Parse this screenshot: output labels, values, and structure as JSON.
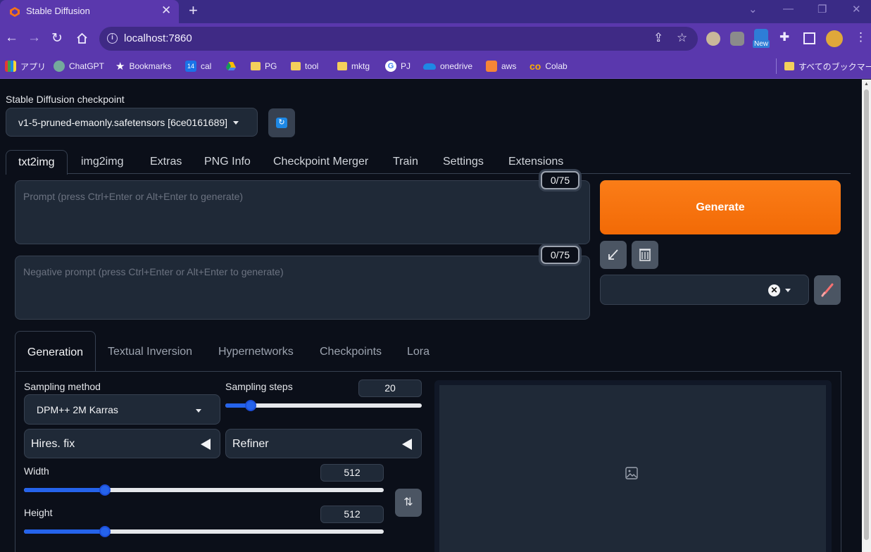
{
  "browser": {
    "tab_title": "Stable Diffusion",
    "close_glyph": "✕",
    "newtab_glyph": "+",
    "url": "localhost:7860",
    "new_badge": "New",
    "bookmarks": [
      {
        "label": "アプリ",
        "icon": "apps-icon"
      },
      {
        "label": "ChatGPT",
        "icon": "chatgpt-icon"
      },
      {
        "label": "Bookmarks",
        "icon": "star-icon"
      },
      {
        "label": "cal",
        "icon": "calendar-icon"
      },
      {
        "label": "",
        "icon": "drive-icon"
      },
      {
        "label": "PG",
        "icon": "folder-icon"
      },
      {
        "label": "tool",
        "icon": "folder-icon"
      },
      {
        "label": "mktg",
        "icon": "folder-icon"
      },
      {
        "label": "PJ",
        "icon": "google-icon"
      },
      {
        "label": "onedrive",
        "icon": "onedrive-icon"
      },
      {
        "label": "aws",
        "icon": "aws-icon"
      },
      {
        "label": "Colab",
        "icon": "colab-icon"
      }
    ],
    "other_bookmarks": "すべてのブックマーク"
  },
  "checkpoint": {
    "label": "Stable Diffusion checkpoint",
    "value": "v1-5-pruned-emaonly.safetensors [6ce0161689]"
  },
  "main_tabs": [
    "txt2img",
    "img2img",
    "Extras",
    "PNG Info",
    "Checkpoint Merger",
    "Train",
    "Settings",
    "Extensions"
  ],
  "prompt": {
    "placeholder": "Prompt (press Ctrl+Enter or Alt+Enter to generate)",
    "counter": "0/75"
  },
  "negative_prompt": {
    "placeholder": "Negative prompt (press Ctrl+Enter or Alt+Enter to generate)",
    "counter": "0/75"
  },
  "generate_label": "Generate",
  "sub_tabs": [
    "Generation",
    "Textual Inversion",
    "Hypernetworks",
    "Checkpoints",
    "Lora"
  ],
  "generation": {
    "sampling_method_label": "Sampling method",
    "sampling_method": "DPM++ 2M Karras",
    "sampling_steps_label": "Sampling steps",
    "sampling_steps": "20",
    "hires_label": "Hires. fix",
    "refiner_label": "Refiner",
    "width_label": "Width",
    "width": "512",
    "height_label": "Height",
    "height": "512",
    "swap_glyph": "⇅"
  },
  "sliders": {
    "sampling_steps": {
      "value": 20,
      "min": 1,
      "max": 150
    },
    "width": {
      "value": 512,
      "min": 64,
      "max": 2048
    },
    "height": {
      "value": 512,
      "min": 64,
      "max": 2048
    }
  },
  "colors": {
    "accent_orange": "#f97316",
    "slider_blue": "#2563eb",
    "browser_purple": "#5a38ad"
  }
}
